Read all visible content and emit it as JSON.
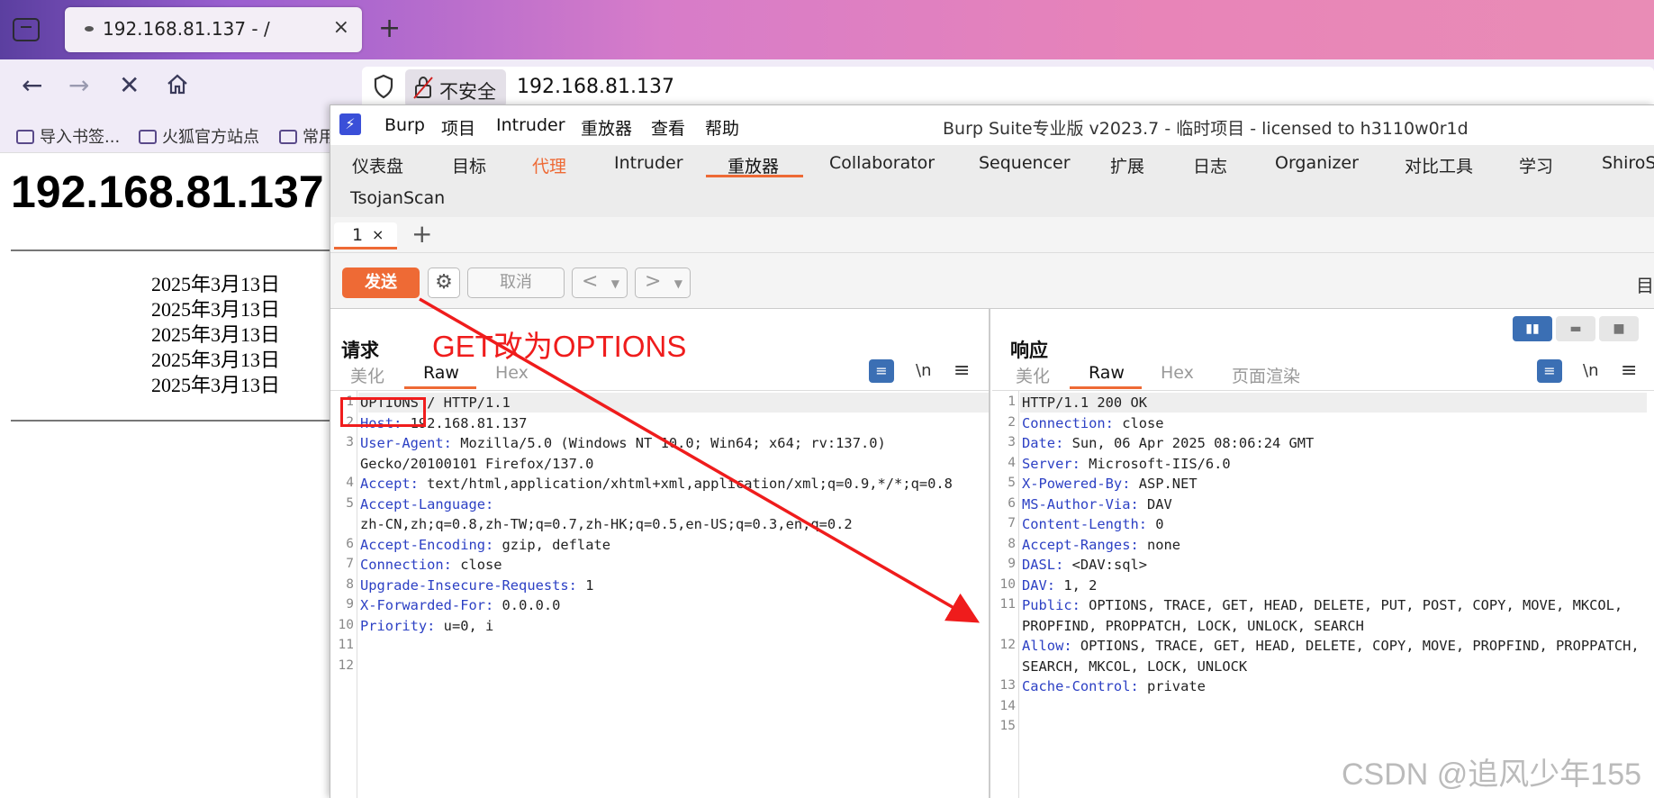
{
  "browser": {
    "tab_title": "192.168.81.137 - /",
    "tab_close": "×",
    "new_tab": "+",
    "insecure_label": "不安全",
    "address": "192.168.81.137",
    "bookmarks": [
      "导入书签...",
      "火狐官方站点",
      "常用"
    ]
  },
  "webpage": {
    "heading": "192.168.81.137",
    "dates": [
      "2025年3月13日",
      "2025年3月13日",
      "2025年3月13日",
      "2025年3月13日",
      "2025年3月13日"
    ]
  },
  "burp": {
    "menu": [
      "Burp",
      "项目",
      "Intruder",
      "重放器",
      "查看",
      "帮助"
    ],
    "window_title": "Burp Suite专业版  v2023.7 - 临时项目 - licensed to h3110w0r1d",
    "main_tabs": [
      "仪表盘",
      "目标",
      "代理",
      "Intruder",
      "重放器",
      "Collaborator",
      "Sequencer",
      "扩展",
      "日志",
      "Organizer",
      "对比工具",
      "学习",
      "ShiroSc",
      "TsojanScan"
    ],
    "active_main_tab": "重放器",
    "subtab_number": "1",
    "subtab_close": "×",
    "subtab_add": "+",
    "send_label": "发送",
    "cancel_label": "取消",
    "toolbar_right": "目",
    "request": {
      "title": "请求",
      "view_tabs": [
        "美化",
        "Raw",
        "Hex"
      ],
      "active_view": "Raw",
      "newline_label": "\\n",
      "menu_label": "≡",
      "lines": [
        {
          "n": "1",
          "key": "",
          "val": "OPTIONS / HTTP/1.1"
        },
        {
          "n": "2",
          "key": "Host:",
          "val": " 192.168.81.137"
        },
        {
          "n": "3",
          "key": "User-Agent:",
          "val": " Mozilla/5.0 (Windows NT 10.0; Win64; x64; rv:137.0)"
        },
        {
          "n": "",
          "key": "",
          "val": "Gecko/20100101 Firefox/137.0"
        },
        {
          "n": "4",
          "key": "Accept:",
          "val": " text/html,application/xhtml+xml,application/xml;q=0.9,*/*;q=0.8"
        },
        {
          "n": "5",
          "key": "Accept-Language:",
          "val": ""
        },
        {
          "n": "",
          "key": "",
          "val": "zh-CN,zh;q=0.8,zh-TW;q=0.7,zh-HK;q=0.5,en-US;q=0.3,en;q=0.2"
        },
        {
          "n": "6",
          "key": "Accept-Encoding:",
          "val": " gzip, deflate"
        },
        {
          "n": "7",
          "key": "Connection:",
          "val": " close"
        },
        {
          "n": "8",
          "key": "Upgrade-Insecure-Requests:",
          "val": " 1"
        },
        {
          "n": "9",
          "key": "X-Forwarded-For:",
          "val": " 0.0.0.0"
        },
        {
          "n": "10",
          "key": "Priority:",
          "val": " u=0, i"
        },
        {
          "n": "11",
          "key": "",
          "val": ""
        },
        {
          "n": "12",
          "key": "",
          "val": ""
        }
      ]
    },
    "response": {
      "title": "响应",
      "view_tabs": [
        "美化",
        "Raw",
        "Hex",
        "页面渲染"
      ],
      "active_view": "Raw",
      "newline_label": "\\n",
      "menu_label": "≡",
      "lines": [
        {
          "n": "1",
          "key": "",
          "val": "HTTP/1.1 200 OK"
        },
        {
          "n": "2",
          "key": "Connection:",
          "val": " close"
        },
        {
          "n": "3",
          "key": "Date:",
          "val": " Sun, 06 Apr 2025 08:06:24 GMT"
        },
        {
          "n": "4",
          "key": "Server:",
          "val": " Microsoft-IIS/6.0"
        },
        {
          "n": "5",
          "key": "X-Powered-By:",
          "val": " ASP.NET"
        },
        {
          "n": "6",
          "key": "MS-Author-Via:",
          "val": " DAV"
        },
        {
          "n": "7",
          "key": "Content-Length:",
          "val": " 0"
        },
        {
          "n": "8",
          "key": "Accept-Ranges:",
          "val": " none"
        },
        {
          "n": "9",
          "key": "DASL:",
          "val": " <DAV:sql>"
        },
        {
          "n": "10",
          "key": "DAV:",
          "val": " 1, 2"
        },
        {
          "n": "11",
          "key": "Public:",
          "val": " OPTIONS, TRACE, GET, HEAD, DELETE, PUT, POST, COPY, MOVE, MKCOL,"
        },
        {
          "n": "",
          "key": "",
          "val": "PROPFIND, PROPPATCH, LOCK, UNLOCK, SEARCH"
        },
        {
          "n": "12",
          "key": "Allow:",
          "val": " OPTIONS, TRACE, GET, HEAD, DELETE, COPY, MOVE, PROPFIND, PROPPATCH,"
        },
        {
          "n": "",
          "key": "",
          "val": "SEARCH, MKCOL, LOCK, UNLOCK"
        },
        {
          "n": "13",
          "key": "Cache-Control:",
          "val": " private"
        },
        {
          "n": "14",
          "key": "",
          "val": ""
        },
        {
          "n": "15",
          "key": "",
          "val": ""
        }
      ]
    }
  },
  "annotation": {
    "text": "GET改为OPTIONS",
    "color": "#ef1c1c"
  },
  "watermark": "CSDN @追风少年155",
  "colors": {
    "burp_accent": "#ee6a35",
    "header_key": "#2c40c4",
    "wrap_button": "#3b6fb4"
  }
}
